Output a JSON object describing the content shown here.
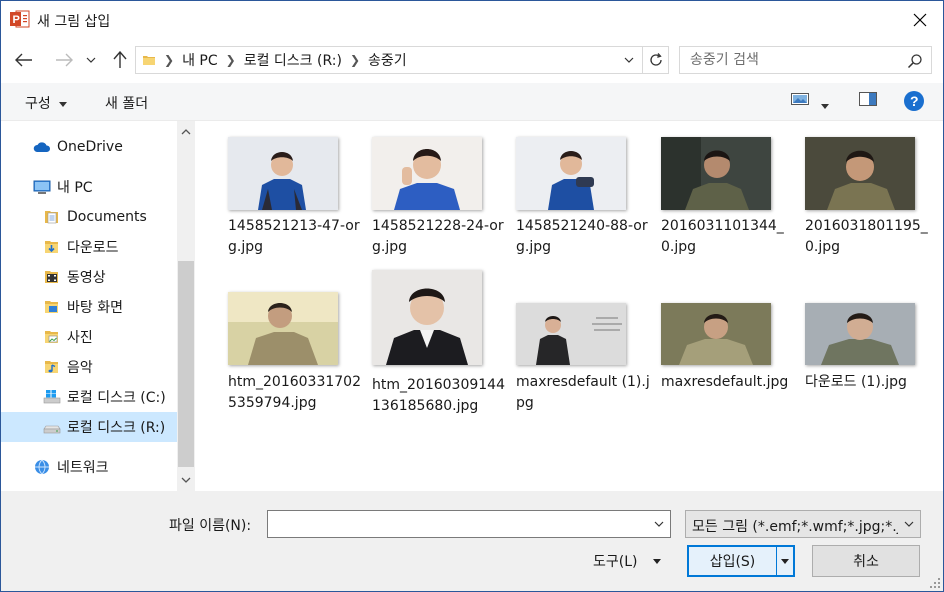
{
  "window": {
    "title": "새 그림 삽입",
    "accent": "#2b579a",
    "app_icon": "powerpoint-icon"
  },
  "address": {
    "crumbs": [
      "내 PC",
      "로컬 디스크 (R:)",
      "송중기"
    ],
    "search_placeholder": "송중기 검색"
  },
  "toolbar": {
    "organize_label": "구성",
    "new_folder_label": "새 폴더"
  },
  "sidebar": {
    "items": [
      {
        "label": "OneDrive",
        "icon": "cloud-icon"
      },
      {
        "label": "내 PC",
        "icon": "computer-icon"
      },
      {
        "label": "Documents",
        "icon": "documents-folder-icon"
      },
      {
        "label": "다운로드",
        "icon": "downloads-folder-icon"
      },
      {
        "label": "동영상",
        "icon": "videos-folder-icon"
      },
      {
        "label": "바탕 화면",
        "icon": "desktop-folder-icon"
      },
      {
        "label": "사진",
        "icon": "pictures-folder-icon"
      },
      {
        "label": "음악",
        "icon": "music-folder-icon"
      },
      {
        "label": "로컬 디스크 (C:)",
        "icon": "windows-drive-icon"
      },
      {
        "label": "로컬 디스크 (R:)",
        "icon": "drive-icon",
        "selected": true
      },
      {
        "label": "네트워크",
        "icon": "network-icon"
      }
    ]
  },
  "files": [
    {
      "name": "1458521213-47-org.jpg"
    },
    {
      "name": "1458521228-24-org.jpg"
    },
    {
      "name": "1458521240-88-org.jpg"
    },
    {
      "name": "2016031101344_0.jpg"
    },
    {
      "name": "2016031801195_0.jpg"
    },
    {
      "name": "htm_201603317025359794.jpg"
    },
    {
      "name": "htm_20160309144136185680.jpg"
    },
    {
      "name": "maxresdefault (1).jpg"
    },
    {
      "name": "maxresdefault.jpg"
    },
    {
      "name": "다운로드 (1).jpg"
    }
  ],
  "footer": {
    "filename_label": "파일 이름(N):",
    "filename_value": "",
    "filter_value": "모든 그림 (*.emf;*.wmf;*.jpg;*.jpeg;*.png)",
    "tools_label": "도구(L)",
    "insert_label": "삽입(S)",
    "cancel_label": "취소"
  }
}
